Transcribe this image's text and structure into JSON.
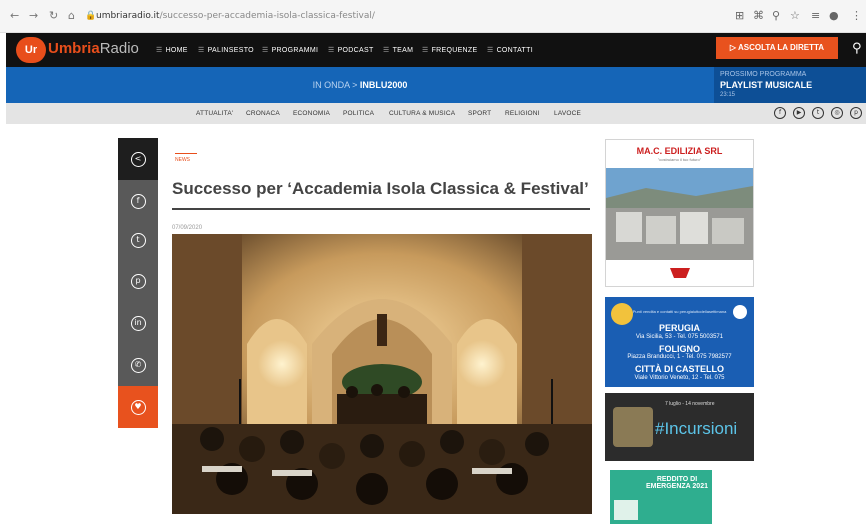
{
  "browser": {
    "url_domain": "umbriaradio.it",
    "url_path": "/successo-per-accademia-isola-classica-festival/"
  },
  "site": {
    "logo_badge": "Ur",
    "logo_name_1": "Umbria",
    "logo_name_2": "Radio",
    "menu": [
      "HOME",
      "PALINSESTO",
      "PROGRAMMI",
      "PODCAST",
      "TEAM",
      "FREQUENZE",
      "CONTATTI"
    ],
    "listen_label": "ASCOLTA LA DIRETTA",
    "on_air_label": "IN ONDA >",
    "on_air_show": "INBLU2000",
    "next_label": "PROSSIMO PROGRAMMA",
    "next_show": "PLAYLIST MUSICALE",
    "next_time": "23:15",
    "categories": [
      "ATTUALITA'",
      "CRONACA",
      "ECONOMIA",
      "POLITICA",
      "CULTURA & MUSICA",
      "SPORT",
      "RELIGIONI",
      "LAVOCE"
    ],
    "social_icons": [
      "facebook-icon",
      "youtube-icon",
      "twitter-icon",
      "instagram-icon",
      "pinterest-icon"
    ]
  },
  "share_icons": [
    "share-icon",
    "facebook-icon",
    "twitter-icon",
    "pinterest-icon",
    "linkedin-icon",
    "whatsapp-icon",
    "heart-icon"
  ],
  "article": {
    "category": "NEWS",
    "title": "Successo per ‘Accademia Isola Classica & Festival’",
    "date": "07/09/2020"
  },
  "ads": {
    "ad1_title": "MA.C. EDILIZIA SRL",
    "ad1_subtitle": "\"costruiamo il tuo futuro\"",
    "ad2": {
      "header": "Punti vendita e contatti su perugiaiuttodellasettimana",
      "city1": "PERUGIA",
      "city1_addr": "Via Sicilia, 53 - Tel. 075 5003571",
      "city2": "FOLIGNO",
      "city2_addr": "Piazza Branducci, 1 - Tel. 075 7982577",
      "city3": "CITTÀ DI CASTELLO",
      "city3_addr": "Viale Vittorio Veneto, 12 - Tel. 075"
    },
    "ad3_date": "7 luglio - 14 novembre",
    "ad3_title": "#Incursioni",
    "ad4_title": "REDDITO DI EMERGENZA 2021"
  },
  "colors": {
    "accent": "#e84e1b",
    "onair_blue": "#1565b7",
    "next_blue": "#0d4f96",
    "share_gray": "#595959"
  }
}
